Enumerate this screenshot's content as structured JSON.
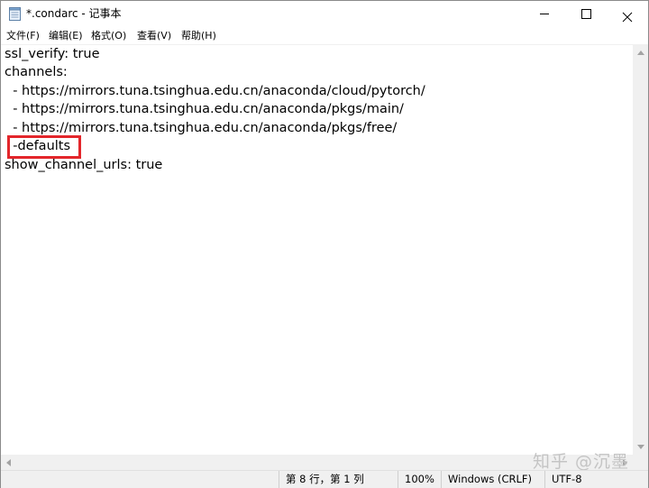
{
  "window": {
    "title": "*.condarc - 记事本"
  },
  "menu": {
    "items": [
      "文件(F)",
      "编辑(E)",
      "格式(O)",
      "查看(V)",
      "帮助(H)"
    ]
  },
  "editor": {
    "lines": [
      "ssl_verify: true",
      "channels:",
      "  - https://mirrors.tuna.tsinghua.edu.cn/anaconda/cloud/pytorch/",
      "  - https://mirrors.tuna.tsinghua.edu.cn/anaconda/pkgs/main/",
      "  - https://mirrors.tuna.tsinghua.edu.cn/anaconda/pkgs/free/",
      "  -defaults",
      "show_channel_urls: true"
    ],
    "highlight_color": "#e3262b"
  },
  "status": {
    "position": "第 8 行，第 1 列",
    "zoom": "100%",
    "line_ending": "Windows (CRLF)",
    "encoding": "UTF-8"
  },
  "watermark": "知乎 @沉墨",
  "icons": {
    "app": "notepad-icon",
    "minimize": "minimize-icon",
    "maximize": "maximize-icon",
    "close": "close-icon"
  }
}
